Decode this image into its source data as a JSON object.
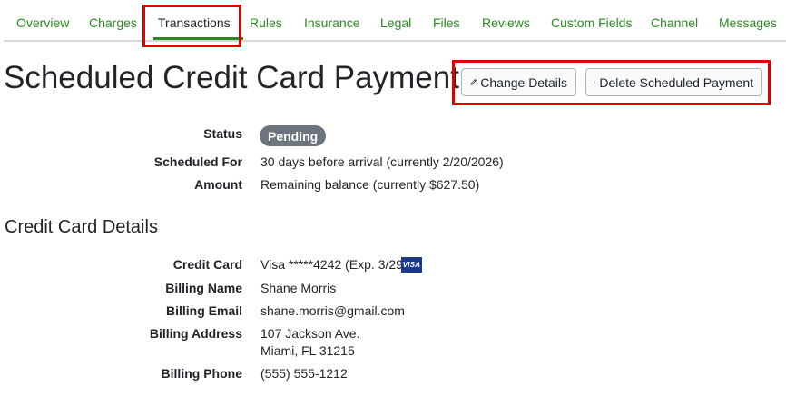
{
  "tabs": [
    {
      "label": "Overview"
    },
    {
      "label": "Charges"
    },
    {
      "label": "Transactions",
      "active": true
    },
    {
      "label": "Rules"
    },
    {
      "label": "Insurance"
    },
    {
      "label": "Legal"
    },
    {
      "label": "Files"
    },
    {
      "label": "Reviews"
    },
    {
      "label": "Custom Fields"
    },
    {
      "label": "Channel"
    },
    {
      "label": "Messages"
    }
  ],
  "page": {
    "title": "Scheduled Credit Card Payment",
    "change_details_label": "Change Details",
    "delete_label": "Delete Scheduled Payment"
  },
  "payment": {
    "status_label": "Status",
    "status_value": "Pending",
    "scheduled_for_label": "Scheduled For",
    "scheduled_for_value": "30 days before arrival (currently 2/20/2026)",
    "amount_label": "Amount",
    "amount_value": "Remaining balance (currently $627.50)"
  },
  "card_details": {
    "section_title": "Credit Card Details",
    "credit_card_label": "Credit Card",
    "credit_card_value": "Visa *****4242 (Exp. 3/29)",
    "card_logo_text": "VISA",
    "billing_name_label": "Billing Name",
    "billing_name_value": "Shane Morris",
    "billing_email_label": "Billing Email",
    "billing_email_value": "shane.morris@gmail.com",
    "billing_address_label": "Billing Address",
    "billing_address_line1": "107 Jackson Ave.",
    "billing_address_line2": "Miami, FL 31215",
    "billing_phone_label": "Billing Phone",
    "billing_phone_value": "(555) 555-1212"
  },
  "colors": {
    "link_green": "#2a8a1f",
    "highlight_red": "#e00000",
    "badge_gray": "#6c757d",
    "visa_blue": "#1a3a8f"
  },
  "icons": {
    "change_details": "pencil-icon",
    "delete": "trash-icon"
  }
}
